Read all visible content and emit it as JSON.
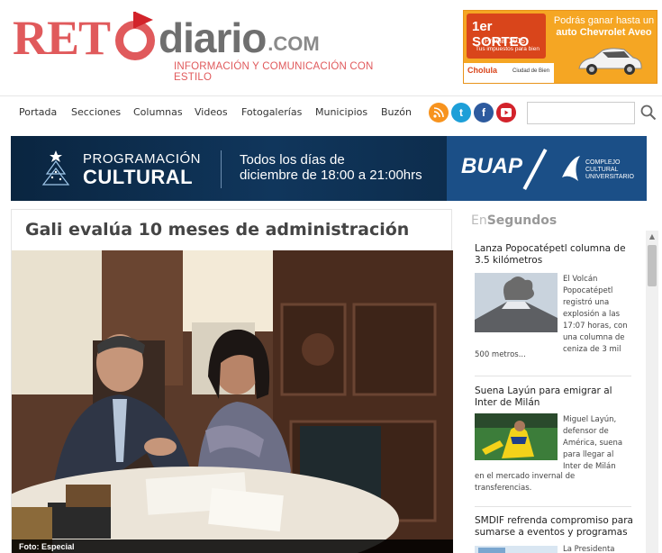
{
  "header": {
    "logo_ret": "RET",
    "logo_diario": "diario",
    "logo_com": ".COM",
    "tagline": "INFORMACIÓN Y COMUNICACIÓN CON ESTILO",
    "ad": {
      "sorteo": "1er SORTEO",
      "predial": "Predial 2015",
      "sub": "Tus impuestos para bien",
      "line1": "Podrás ganar hasta un",
      "line2": "auto Chevrolet Aveo",
      "cholula": "Cholula",
      "ciudad": "Ciudad de Bien"
    }
  },
  "nav": {
    "items": [
      "Portada",
      "Secciones",
      "Columnas",
      "Videos",
      "Fotogalerías",
      "Municipios",
      "Buzón"
    ],
    "search_placeholder": ""
  },
  "banner": {
    "prog1": "PROGRAMACIÓN",
    "prog2": "CULTURAL",
    "todos1": "Todos los días de",
    "todos2": "diciembre de 18:00 a 21:00hrs",
    "buap": "BUAP",
    "complejo1": "COMPLEJO",
    "complejo2": "CULTURAL",
    "complejo3": "UNIVERSITARIO"
  },
  "article": {
    "title": "Gali evalúa 10 meses de administración",
    "caption": "Foto: Especial"
  },
  "sidebar": {
    "title_en": "En",
    "title_rest": "Segundos",
    "items": [
      {
        "head": "Lanza Popocatépetl columna de 3.5 kilómetros",
        "body_side": [
          "El Volcán",
          "Popocatépetl",
          "registró una",
          "explosión a las",
          "17:07 horas, con",
          "una columna de",
          "ceniza de 3 mil"
        ],
        "body_full": "500 metros..."
      },
      {
        "head": "Suena Layún para emigrar al Inter de Milán",
        "body_side": [
          "Miguel Layún,",
          "defensor de",
          "América, suena",
          "para llegar al",
          "Inter de Milán"
        ],
        "body_full1": "en el mercado invernal de",
        "body_full2": "transferencias."
      },
      {
        "head": "SMDIF refrenda compromiso para sumarse a eventos y programas",
        "body_side": [
          "La Presidenta"
        ]
      }
    ]
  },
  "colors": {
    "brand_red": "#e05a5c",
    "banner_navy": "#0b2a4a",
    "ad_orange": "#f5a623"
  }
}
